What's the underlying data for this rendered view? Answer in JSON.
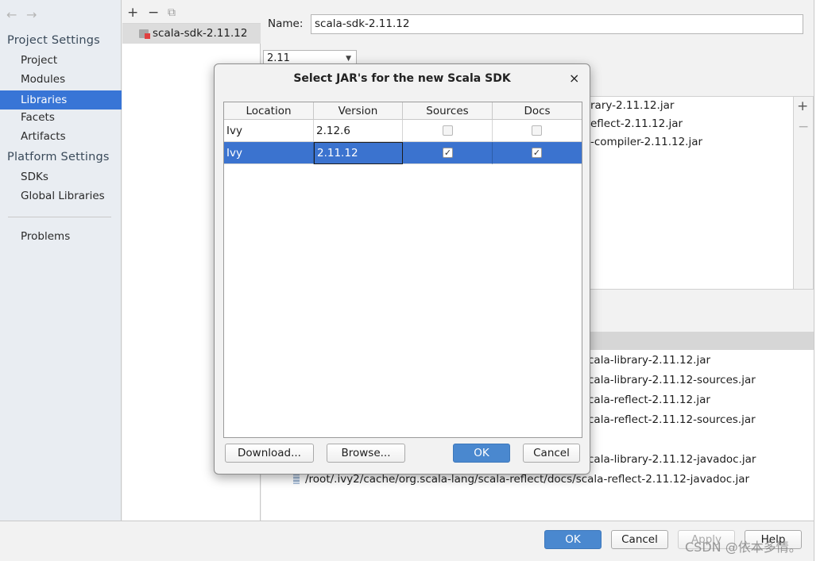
{
  "sidebar": {
    "back_icon": "←",
    "forward_icon": "→",
    "project_settings": "Project Settings",
    "project_items": [
      "Project",
      "Modules",
      "Libraries",
      "Facets",
      "Artifacts"
    ],
    "platform_settings": "Platform Settings",
    "platform_items": [
      "SDKs",
      "Global Libraries"
    ],
    "problems": "Problems"
  },
  "library_list": {
    "toolbar": {
      "add": "+",
      "remove": "−",
      "copy": "⧉"
    },
    "items": [
      "scala-sdk-2.11.12"
    ]
  },
  "details": {
    "name_label": "Name:",
    "name_value": "scala-sdk-2.11.12",
    "version_value": "2.11",
    "classes_side_add": "+",
    "classes_side_remove": "−",
    "classes": [
      "rary-2.11.12.jar",
      "eflect-2.11.12.jar",
      "-compiler-2.11.12.jar"
    ],
    "sources": [
      "cala-library-2.11.12.jar",
      "cala-library-2.11.12-sources.jar",
      "cala-reflect-2.11.12.jar",
      "cala-reflect-2.11.12-sources.jar",
      "cala-library-2.11.12-javadoc.jar"
    ],
    "docs_full_path": "/root/.ivy2/cache/org.scala-lang/scala-reflect/docs/scala-reflect-2.11.12-javadoc.jar"
  },
  "dialog": {
    "title": "Select JAR's for the new Scala SDK",
    "close": "×",
    "columns": [
      "Location",
      "Version",
      "Sources",
      "Docs"
    ],
    "rows": [
      {
        "location": "Ivy",
        "version": "2.12.6",
        "sources": "",
        "docs": ""
      },
      {
        "location": "Ivy",
        "version": "2.11.12",
        "sources": "✓",
        "docs": "✓"
      }
    ],
    "buttons": {
      "download": "Download...",
      "browse": "Browse...",
      "ok": "OK",
      "cancel": "Cancel"
    }
  },
  "bottom": {
    "ok": "OK",
    "cancel": "Cancel",
    "apply": "Apply",
    "help": "Help"
  },
  "watermark": "CSDN @依本多情。",
  "colors": {
    "selection": "#3875d6",
    "primary_button": "#4a88cf"
  }
}
